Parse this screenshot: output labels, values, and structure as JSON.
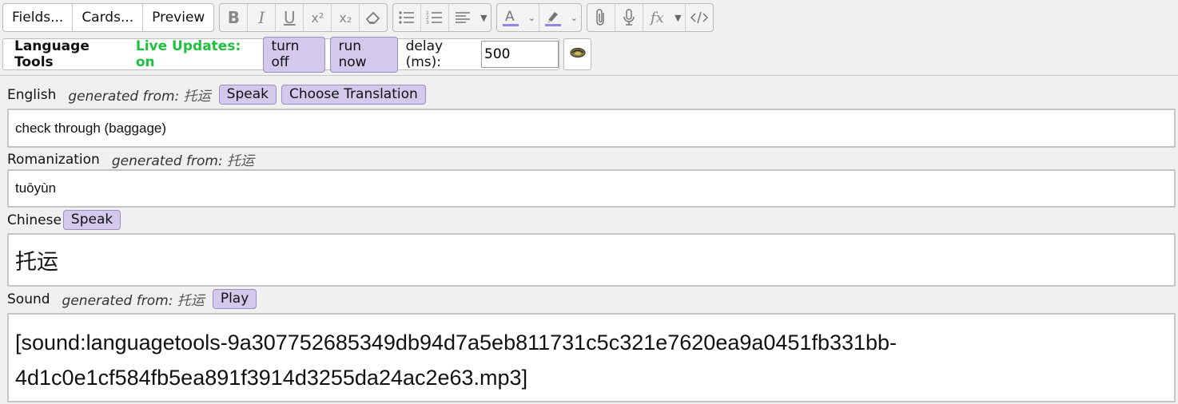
{
  "toolbar": {
    "fields_label": "Fields...",
    "cards_label": "Cards...",
    "preview_label": "Preview",
    "bold_label": "B",
    "italic_label": "I",
    "underline_label": "U",
    "superscript_label": "x²",
    "subscript_label": "x₂",
    "mathjax_label": "fx",
    "accent_color": "#8f86e6"
  },
  "language_tools": {
    "title": "Language Tools",
    "live_updates": "Live Updates: on",
    "turn_off_label": "turn off",
    "run_now_label": "run now",
    "delay_label": "delay (ms):",
    "delay_value": "500"
  },
  "fields": [
    {
      "name": "English",
      "generated_from_label": "generated from:",
      "generated_from_value": "托运",
      "buttons": [
        "Speak",
        "Choose Translation"
      ],
      "value": "check through (baggage)"
    },
    {
      "name": "Romanization",
      "generated_from_label": "generated from:",
      "generated_from_value": "托运",
      "value": "tuōyùn"
    },
    {
      "name": "Chinese",
      "buttons": [
        "Speak"
      ],
      "value": "托运"
    },
    {
      "name": "Sound",
      "generated_from_label": "generated from:",
      "generated_from_value": "托运",
      "buttons": [
        "Play"
      ],
      "value_line1": "[sound:languagetools-9a307752685349db94d7a5eb811731c5c321e7620ea9a0451fb331bb-",
      "value_line2": "4d1c0e1cf584fb5ea891f3914d3255da24ac2e63.mp3]"
    }
  ]
}
